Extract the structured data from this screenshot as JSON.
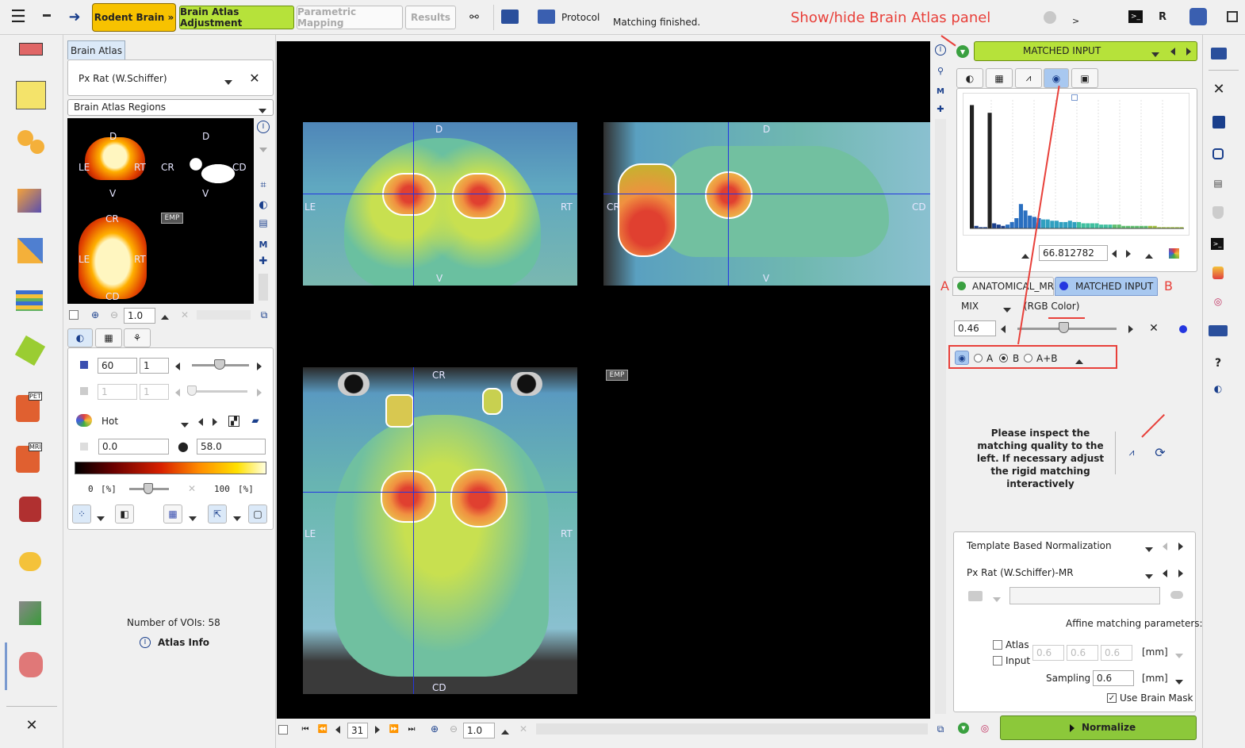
{
  "toolbar": {
    "rodent_brain": "Rodent Brain »",
    "brain_atlas_adjustment": "Brain Atlas Adjustment",
    "parametric_mapping": "Parametric Mapping",
    "results": "Results",
    "protocol": "Protocol",
    "status": "Matching finished.",
    "console_label": ">",
    "r_label": "R"
  },
  "annotation": {
    "show_hide": "Show/hide Brain Atlas panel",
    "label_a": "A",
    "label_b": "B"
  },
  "colors": {
    "accent_yellow": "#f7c200",
    "accent_green": "#b6e23a",
    "annotation_red": "#e8403a",
    "viewer_bg": "#000000",
    "crosshair": "#2436e0"
  },
  "atlas_panel": {
    "tab": "Brain Atlas",
    "atlas_name": "Px Rat (W.Schiffer)",
    "region_select": "Brain Atlas Regions",
    "emp": "EMP",
    "zoom": "1.0",
    "lower": "60",
    "upper": "1",
    "lower2": "1",
    "upper2": "1",
    "colormap": "Hot",
    "min": "0.0",
    "max": "58.0",
    "scale_min": "0",
    "scale_unit": "[%]",
    "scale_max": "100",
    "voi_count": "Number of VOIs: 58",
    "atlas_info": "Atlas Info",
    "mini_labels": {
      "d": "D",
      "v": "V",
      "le": "LE",
      "rt": "RT",
      "cr": "CR",
      "cd": "CD"
    }
  },
  "viewer": {
    "labels": {
      "d": "D",
      "v": "V",
      "le": "LE",
      "rt": "RT",
      "cr": "CR",
      "cd": "CD"
    },
    "emp": "EMP",
    "slice": "31",
    "zoom": "1.0"
  },
  "right_panel": {
    "matched_input": "MATCHED INPUT",
    "threshold": "66.812782",
    "tab_a": "ANATOMICAL_MR",
    "tab_b": "MATCHED INPUT",
    "mix_label": "MIX",
    "mix_mode": "(RGB Color)",
    "mix_value": "0.46",
    "mix_fraction": 0.46,
    "radio_a": "A",
    "radio_b": "B",
    "radio_ab": "A+B",
    "radio_selected": "B",
    "inspect_text": "Please inspect the matching quality to the left. If necessary adjust the rigid matching interactively",
    "norm_method": "Template Based Normalization",
    "norm_template": "Px Rat (W.Schiffer)-MR",
    "affine_label": "Affine matching parameters:",
    "atlas_cb": "Atlas",
    "input_cb": "Input",
    "atlas_vals": [
      "0.6",
      "0.6",
      "0.6"
    ],
    "mm": "[mm]",
    "sampling_label": "Sampling",
    "sampling_value": "0.6",
    "use_brain_mask": "Use Brain Mask",
    "use_brain_mask_checked": true,
    "normalize": "Normalize"
  },
  "histogram": {
    "bars": [
      0.96,
      0.02,
      0.01,
      0.01,
      0.9,
      0.04,
      0.03,
      0.02,
      0.03,
      0.05,
      0.08,
      0.19,
      0.14,
      0.1,
      0.09,
      0.08,
      0.07,
      0.07,
      0.06,
      0.06,
      0.05,
      0.05,
      0.06,
      0.05,
      0.05,
      0.04,
      0.04,
      0.04,
      0.04,
      0.03,
      0.03,
      0.03,
      0.03,
      0.03,
      0.02,
      0.02,
      0.02,
      0.02,
      0.02,
      0.02,
      0.02,
      0.02,
      0.01,
      0.01,
      0.01,
      0.01,
      0.01,
      0.01
    ]
  }
}
